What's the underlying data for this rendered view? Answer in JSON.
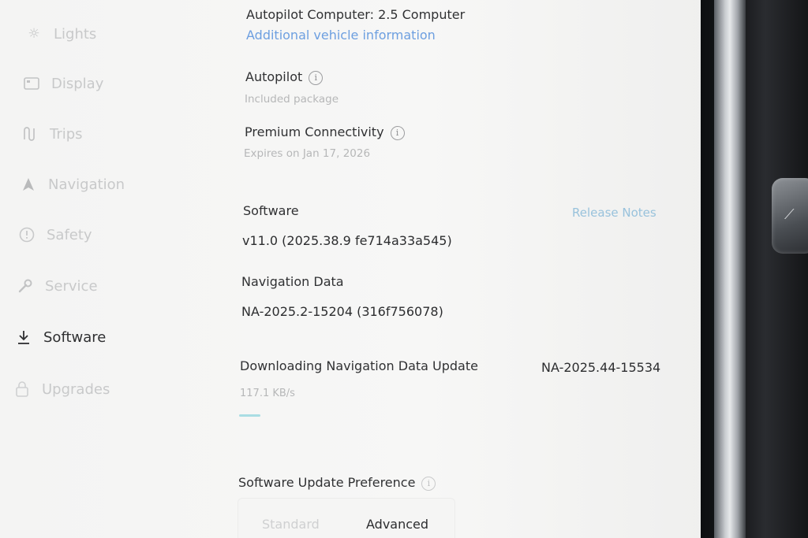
{
  "sidebar": {
    "items": [
      {
        "label": "Lights",
        "icon": "sun-icon"
      },
      {
        "label": "Display",
        "icon": "display-icon"
      },
      {
        "label": "Trips",
        "icon": "trips-icon"
      },
      {
        "label": "Navigation",
        "icon": "navigation-arrow-icon"
      },
      {
        "label": "Safety",
        "icon": "alert-circle-icon"
      },
      {
        "label": "Service",
        "icon": "wrench-icon"
      },
      {
        "label": "Software",
        "icon": "download-icon",
        "active": true
      },
      {
        "label": "Upgrades",
        "icon": "lock-icon"
      }
    ]
  },
  "vehicle": {
    "autopilot_computer": "Autopilot Computer: 2.5 Computer",
    "additional_info_link": "Additional vehicle information"
  },
  "autopilot": {
    "title": "Autopilot",
    "status": "Included package"
  },
  "connectivity": {
    "title": "Premium Connectivity",
    "status": "Expires on Jan 17, 2026"
  },
  "software": {
    "title": "Software",
    "release_notes": "Release Notes",
    "version": "v11.0 (2025.38.9 fe714a33a545)"
  },
  "nav_data": {
    "title": "Navigation Data",
    "version": "NA-2025.2-15204 (316f756078)"
  },
  "download": {
    "title": "Downloading Navigation Data Update",
    "target_version": "NA-2025.44-15534",
    "speed": "117.1 KB/s",
    "progress": 0.05
  },
  "update_pref": {
    "title": "Software Update Preference",
    "options": [
      "Standard",
      "Advanced"
    ],
    "selected": "Advanced"
  },
  "colors": {
    "accent_link": "#6d9fe0",
    "progress": "#a9dde3",
    "active_text": "#2e2f31",
    "inactive_text": "#c8c9ca"
  }
}
